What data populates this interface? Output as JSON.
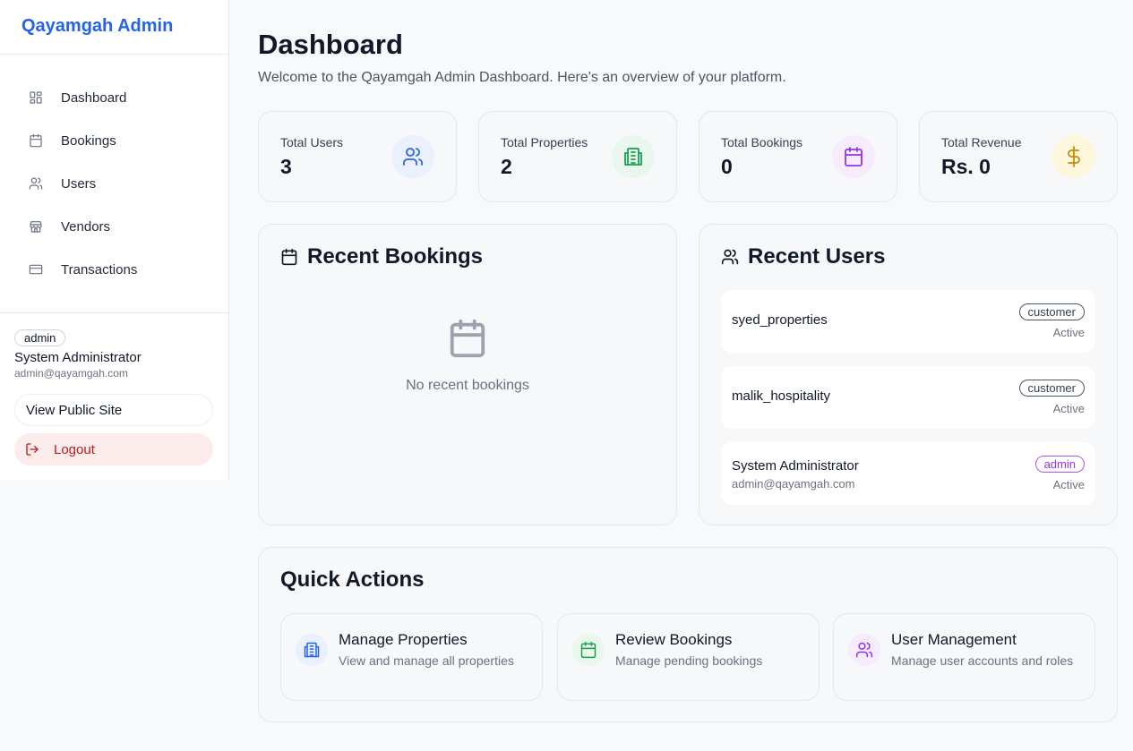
{
  "sidebar": {
    "brand": "Qayamgah Admin",
    "items": [
      {
        "label": "Dashboard",
        "icon": "layout-grid-icon"
      },
      {
        "label": "Bookings",
        "icon": "calendar-icon"
      },
      {
        "label": "Users",
        "icon": "users-icon"
      },
      {
        "label": "Vendors",
        "icon": "store-icon"
      },
      {
        "label": "Transactions",
        "icon": "credit-card-icon"
      }
    ],
    "account": {
      "role": "admin",
      "name": "System Administrator",
      "email": "admin@qayamgah.com"
    },
    "view_public_label": "View Public Site",
    "logout_label": "Logout"
  },
  "header": {
    "title": "Dashboard",
    "subtitle": "Welcome to the Qayamgah Admin Dashboard. Here's an overview of your platform."
  },
  "stats": [
    {
      "label": "Total Users",
      "value": "3",
      "icon": "users-icon",
      "color": "#2563eb"
    },
    {
      "label": "Total Properties",
      "value": "2",
      "icon": "building-icon",
      "color": "#16a34a"
    },
    {
      "label": "Total Bookings",
      "value": "0",
      "icon": "calendar-icon",
      "color": "#9333ea"
    },
    {
      "label": "Total Revenue",
      "value": "Rs. 0",
      "icon": "dollar-icon",
      "color": "#ca8a04"
    }
  ],
  "recent_bookings": {
    "title": "Recent Bookings",
    "empty_text": "No recent bookings"
  },
  "recent_users": {
    "title": "Recent Users",
    "users": [
      {
        "name": "syed_properties",
        "email": "",
        "role": "customer",
        "status": "Active"
      },
      {
        "name": "malik_hospitality",
        "email": "",
        "role": "customer",
        "status": "Active"
      },
      {
        "name": "System Administrator",
        "email": "admin@qayamgah.com",
        "role": "admin",
        "status": "Active"
      }
    ]
  },
  "quick_actions": {
    "title": "Quick Actions",
    "items": [
      {
        "title": "Manage Properties",
        "desc": "View and manage all properties",
        "icon": "building-icon",
        "color": "#2563eb"
      },
      {
        "title": "Review Bookings",
        "desc": "Manage pending bookings",
        "icon": "calendar-icon",
        "color": "#16a34a"
      },
      {
        "title": "User Management",
        "desc": "Manage user accounts and roles",
        "icon": "users-icon",
        "color": "#9333ea"
      }
    ]
  }
}
